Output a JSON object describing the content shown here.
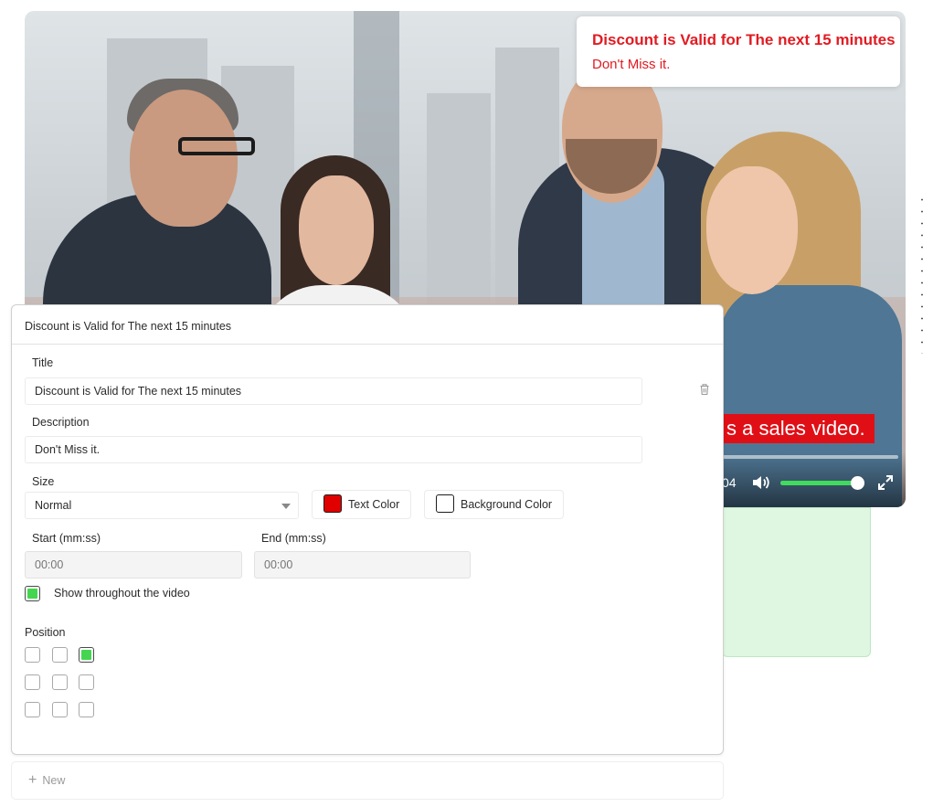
{
  "overlay": {
    "title": "Discount is Valid for The next 15 minutes",
    "description": "Don't Miss it.",
    "title_color": "#e11b22"
  },
  "video": {
    "caption": "s a sales video.",
    "time": "04",
    "caption_bg": "#e00f16",
    "volume_fraction": 0.98,
    "volume_color": "#3fdc5c"
  },
  "editor": {
    "header": "Discount is Valid for The next 15 minutes",
    "title_label": "Title",
    "title_value": "Discount is Valid for The next 15 minutes",
    "description_label": "Description",
    "description_value": "Don't Miss it.",
    "size_label": "Size",
    "size_value": "Normal",
    "text_color_label": "Text Color",
    "text_color": "#e00000",
    "background_color_label": "Background Color",
    "background_color": "#ffffff",
    "start_label": "Start (mm:ss)",
    "start_placeholder": "00:00",
    "end_label": "End (mm:ss)",
    "end_placeholder": "00:00",
    "show_throughout_label": "Show throughout the video",
    "show_throughout_checked": true,
    "position_label": "Position",
    "position_grid": [
      [
        false,
        false,
        true
      ],
      [
        false,
        false,
        false
      ],
      [
        false,
        false,
        false
      ]
    ],
    "check_color": "#44d650"
  },
  "new_button": {
    "icon": "plus-icon",
    "label": "New"
  }
}
